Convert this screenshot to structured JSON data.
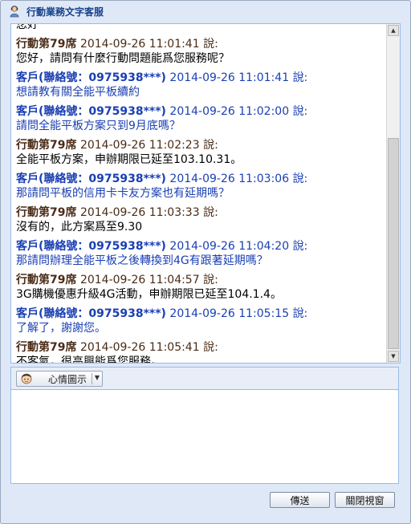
{
  "window": {
    "title": "行動業務文字客服"
  },
  "chat": {
    "messages": [
      {
        "role": "agent",
        "sender": "",
        "time": "",
        "said": "",
        "text": "您好"
      },
      {
        "role": "agent",
        "sender": "行動第79席",
        "time": "2014-09-26 11:01:41",
        "said": "說:",
        "text": "您好，請問有什麼行動問題能爲您服務呢？"
      },
      {
        "role": "cust",
        "sender": "客戶(聯絡號：0975938***)",
        "time": "2014-09-26 11:01:41",
        "said": "說:",
        "text": "想請教有關全能平板續約"
      },
      {
        "role": "cust",
        "sender": "客戶(聯絡號：0975938***)",
        "time": "2014-09-26 11:02:00",
        "said": "說:",
        "text": "請問全能平板方案只到9月底嗎？"
      },
      {
        "role": "agent",
        "sender": "行動第79席",
        "time": "2014-09-26 11:02:23",
        "said": "說:",
        "text": "全能平板方案，申辦期限已延至103.10.31。"
      },
      {
        "role": "cust",
        "sender": "客戶(聯絡號：0975938***)",
        "time": "2014-09-26 11:03:06",
        "said": "說:",
        "text": "那請問平板的信用卡卡友方案也有延期嗎？"
      },
      {
        "role": "agent",
        "sender": "行動第79席",
        "time": "2014-09-26 11:03:33",
        "said": "說:",
        "text": "沒有的，此方案爲至9.30"
      },
      {
        "role": "cust",
        "sender": "客戶(聯絡號：0975938***)",
        "time": "2014-09-26 11:04:20",
        "said": "說:",
        "text": "那請問辦理全能平板之後轉換到4G有跟著延期嗎？"
      },
      {
        "role": "agent",
        "sender": "行動第79席",
        "time": "2014-09-26 11:04:57",
        "said": "說:",
        "text": "3G購機優惠升級4G活動，申辦期限已延至104.1.4。"
      },
      {
        "role": "cust",
        "sender": "客戶(聯絡號：0975938***)",
        "time": "2014-09-26 11:05:15",
        "said": "說:",
        "text": "了解了，謝謝您。"
      },
      {
        "role": "agent",
        "sender": "行動第79席",
        "time": "2014-09-26 11:05:41",
        "said": "說:",
        "text": "不客氣，很高興能爲您服務。"
      }
    ]
  },
  "toolbar": {
    "mood_label": "心情圖示",
    "mood_icon": "face-icon"
  },
  "input": {
    "value": "",
    "placeholder": ""
  },
  "buttons": {
    "send": "傳送",
    "close": "關閉視窗"
  },
  "colors": {
    "agent": "#4a2b16",
    "customer": "#1a3fb3",
    "title": "#15428b"
  }
}
